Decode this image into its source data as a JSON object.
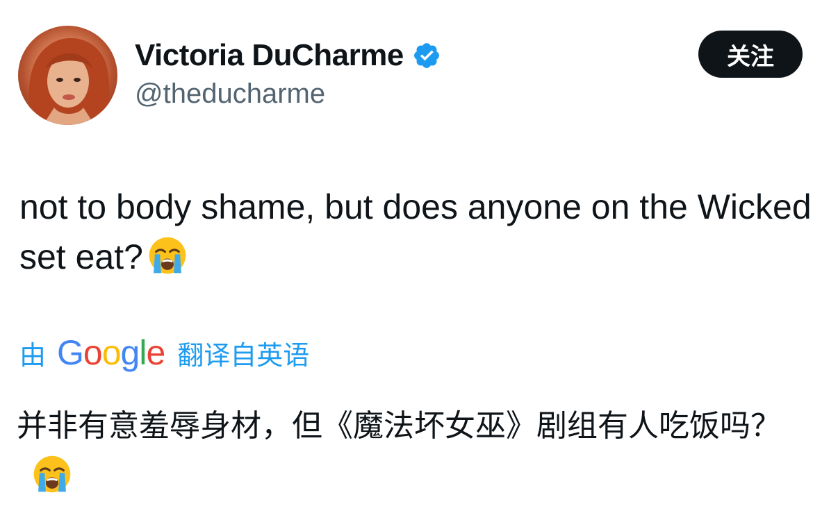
{
  "author": {
    "display_name": "Victoria DuCharme",
    "handle": "@theducharme",
    "verified": true,
    "avatar_icon": "profile-photo"
  },
  "follow_button": {
    "label": "关注"
  },
  "tweet": {
    "text": "not to body shame, but does anyone on the Wicked set eat?",
    "emoji": "loudly-crying-face"
  },
  "translation": {
    "prefix": "由",
    "provider": "Google",
    "suffix": "翻译自英语",
    "text": "并非有意羞辱身材，但《魔法坏女巫》剧组有人吃饭吗？",
    "emoji": "loudly-crying-face"
  },
  "colors": {
    "verified_blue": "#1d9bf0",
    "handle_gray": "#536471",
    "text_dark": "#0f1419",
    "link_blue": "#1d9bf0"
  }
}
